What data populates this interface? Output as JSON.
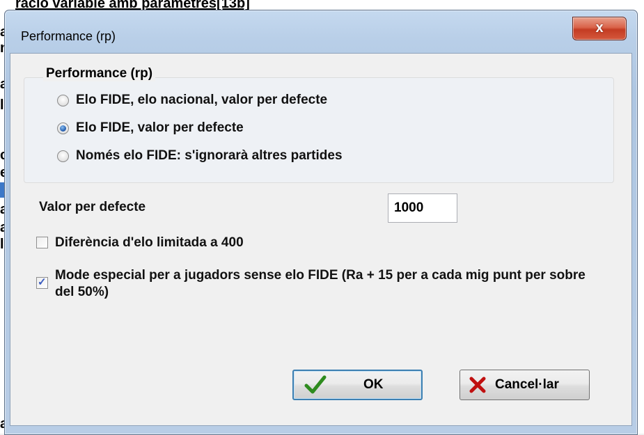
{
  "background": {
    "top_text": "racio variable amb parametres[13b]",
    "edge_letters": [
      "a",
      "n",
      "a",
      "l",
      "c",
      "e",
      "a",
      "a",
      "l",
      "a"
    ]
  },
  "window": {
    "title": "Performance (rp)",
    "close_label": "x"
  },
  "group": {
    "label": "Performance (rp)",
    "options": [
      {
        "label": "Elo FIDE, elo nacional, valor per defecte",
        "checked": false
      },
      {
        "label": "Elo FIDE, valor per defecte",
        "checked": true
      },
      {
        "label": "Només elo FIDE: s'ignorarà altres partides",
        "checked": false
      }
    ]
  },
  "default_value": {
    "label": "Valor per defecte",
    "value": "1000"
  },
  "checkboxes": [
    {
      "label": "Diferència d'elo limitada a 400",
      "checked": false
    },
    {
      "label": "Mode especial per a jugadors sense elo FIDE (Ra + 15 per a cada mig punt per sobre del 50%)",
      "checked": true
    }
  ],
  "buttons": {
    "ok": "OK",
    "cancel": "Cancel·lar"
  },
  "colors": {
    "ok_icon": "#2e8b1e",
    "cancel_icon": "#c01010",
    "close_button": "#c94a30"
  }
}
